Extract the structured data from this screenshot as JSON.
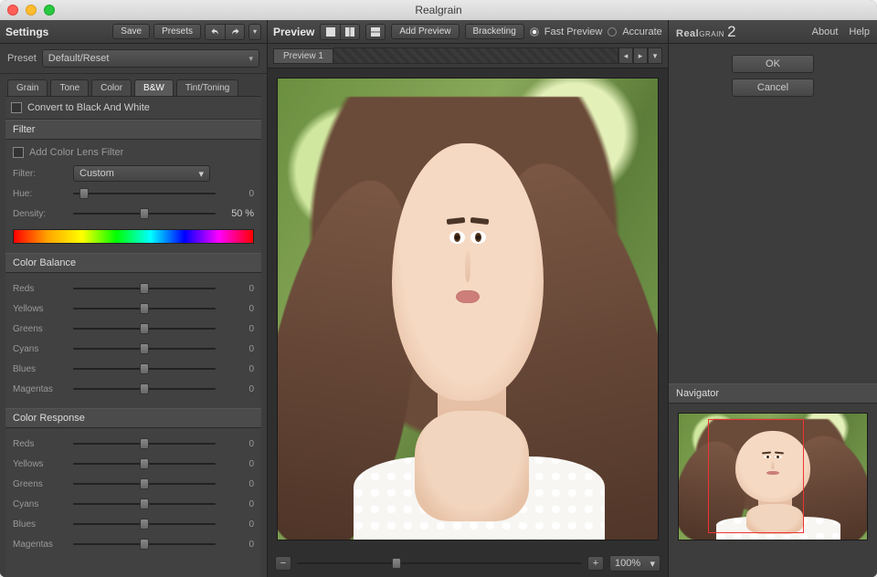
{
  "window": {
    "title": "Realgrain"
  },
  "settings": {
    "header": "Settings",
    "save": "Save",
    "presets": "Presets",
    "preset_label": "Preset",
    "preset_value": "Default/Reset",
    "tabs": [
      "Grain",
      "Tone",
      "Color",
      "B&W",
      "Tint/Toning"
    ],
    "active_tab": "B&W",
    "convert_label": "Convert to Black And White",
    "filter": {
      "group": "Filter",
      "add_label": "Add Color Lens Filter",
      "filter_label": "Filter:",
      "filter_value": "Custom",
      "hue_label": "Hue:",
      "hue_value": "0",
      "density_label": "Density:",
      "density_value": "50",
      "density_unit": "%"
    },
    "color_balance": {
      "group": "Color Balance",
      "rows": [
        {
          "label": "Reds",
          "value": "0"
        },
        {
          "label": "Yellows",
          "value": "0"
        },
        {
          "label": "Greens",
          "value": "0"
        },
        {
          "label": "Cyans",
          "value": "0"
        },
        {
          "label": "Blues",
          "value": "0"
        },
        {
          "label": "Magentas",
          "value": "0"
        }
      ]
    },
    "color_response": {
      "group": "Color Response",
      "rows": [
        {
          "label": "Reds",
          "value": "0"
        },
        {
          "label": "Yellows",
          "value": "0"
        },
        {
          "label": "Greens",
          "value": "0"
        },
        {
          "label": "Cyans",
          "value": "0"
        },
        {
          "label": "Blues",
          "value": "0"
        },
        {
          "label": "Magentas",
          "value": "0"
        }
      ]
    }
  },
  "preview": {
    "header": "Preview",
    "add": "Add Preview",
    "bracketing": "Bracketing",
    "fast": "Fast Preview",
    "accurate": "Accurate",
    "tab1": "Preview 1",
    "zoom": "100%"
  },
  "brand": {
    "name1": "Real",
    "name2": "grain",
    "ver": "2"
  },
  "menu": {
    "about": "About",
    "help": "Help"
  },
  "actions": {
    "ok": "OK",
    "cancel": "Cancel"
  },
  "navigator": {
    "header": "Navigator"
  }
}
